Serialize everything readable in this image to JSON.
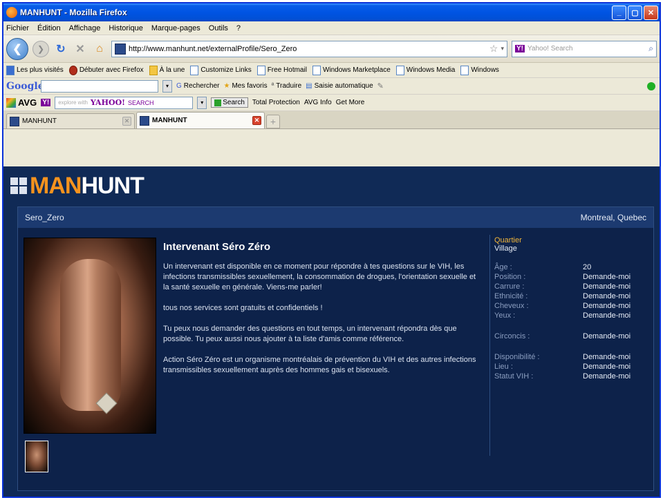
{
  "window": {
    "title": "MANHUNT - Mozilla Firefox"
  },
  "menu": [
    "Fichier",
    "Édition",
    "Affichage",
    "Historique",
    "Marque-pages",
    "Outils",
    "?"
  ],
  "nav": {
    "url": "http://www.manhunt.net/externalProfile/Sero_Zero",
    "search_placeholder": "Yahoo! Search"
  },
  "bookmarks": [
    {
      "label": "Les plus visités",
      "icon": "blue"
    },
    {
      "label": "Débuter avec Firefox",
      "icon": "red"
    },
    {
      "label": "À la une",
      "icon": "gold"
    },
    {
      "label": "Customize Links",
      "icon": "white"
    },
    {
      "label": "Free Hotmail",
      "icon": "white"
    },
    {
      "label": "Windows Marketplace",
      "icon": "white"
    },
    {
      "label": "Windows Media",
      "icon": "white"
    },
    {
      "label": "Windows",
      "icon": "white"
    }
  ],
  "google_toolbar": {
    "logo": "Google",
    "items": [
      "Rechercher",
      "Mes favoris",
      "Traduire",
      "Saisie automatique"
    ]
  },
  "avg_toolbar": {
    "logo": "AVG",
    "search_hint": "explore with",
    "yahoo": "YAHOO!",
    "yahoo_search": "SEARCH",
    "search_btn": "Search",
    "items": [
      "Total Protection",
      "AVG Info",
      "Get More"
    ]
  },
  "tabs": [
    {
      "label": "MANHUNT",
      "active": false
    },
    {
      "label": "MANHUNT",
      "active": true
    }
  ],
  "site": {
    "logo_man": "MAN",
    "logo_hunt": "HUNT"
  },
  "profile": {
    "username": "Sero_Zero",
    "location": "Montreal, Quebec",
    "headline": "Intervenant Séro Zéro",
    "paragraphs": [
      "Un intervenant est disponible en ce moment pour répondre à tes questions sur le VIH, les infections transmissibles sexuellement, la consommation de drogues, l'orientation sexuelle et la santé sexuelle en générale. Viens-me parler!",
      "tous nos services sont gratuits et confidentiels !",
      "Tu peux nous demander des questions en tout temps, un intervenant répondra dès que possible. Tu peux aussi nous ajouter à ta liste d'amis comme référence.",
      "Action Séro Zéro est un organisme montréalais de prévention du VIH et des autres infections transmissibles sexuellement auprès des hommes gais et bisexuels."
    ],
    "quartier_label": "Quartier",
    "quartier_value": "Village",
    "attributes_1": [
      {
        "k": "Âge :",
        "v": "20"
      },
      {
        "k": "Position :",
        "v": "Demande-moi"
      },
      {
        "k": "Carrure :",
        "v": "Demande-moi"
      },
      {
        "k": "Ethnicité :",
        "v": "Demande-moi"
      },
      {
        "k": "Cheveux :",
        "v": "Demande-moi"
      },
      {
        "k": "Yeux :",
        "v": "Demande-moi"
      }
    ],
    "attributes_2": [
      {
        "k": "Circoncis :",
        "v": "Demande-moi"
      }
    ],
    "attributes_3": [
      {
        "k": "Disponibilité :",
        "v": "Demande-moi"
      },
      {
        "k": "Lieu :",
        "v": "Demande-moi"
      },
      {
        "k": "Statut VIH :",
        "v": "Demande-moi"
      }
    ]
  }
}
